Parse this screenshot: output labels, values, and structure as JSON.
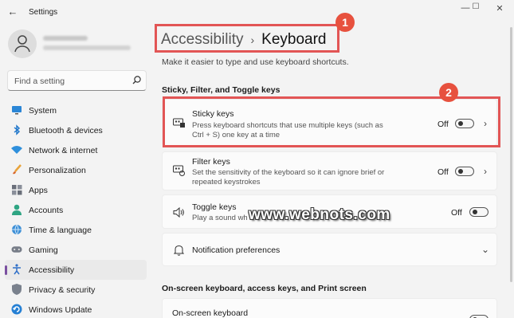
{
  "window": {
    "title": "Settings",
    "back_glyph": "←",
    "min_glyph": "—",
    "max_glyph": "☐",
    "close_glyph": "✕"
  },
  "sidebar": {
    "search_placeholder": "Find a setting",
    "items": [
      {
        "label": "System",
        "icon": "system-icon",
        "active": false
      },
      {
        "label": "Bluetooth & devices",
        "icon": "bluetooth-icon",
        "active": false
      },
      {
        "label": "Network & internet",
        "icon": "network-icon",
        "active": false
      },
      {
        "label": "Personalization",
        "icon": "brush-icon",
        "active": false
      },
      {
        "label": "Apps",
        "icon": "apps-icon",
        "active": false
      },
      {
        "label": "Accounts",
        "icon": "accounts-icon",
        "active": false
      },
      {
        "label": "Time & language",
        "icon": "globe-icon",
        "active": false
      },
      {
        "label": "Gaming",
        "icon": "gamepad-icon",
        "active": false
      },
      {
        "label": "Accessibility",
        "icon": "accessibility-icon",
        "active": true
      },
      {
        "label": "Privacy & security",
        "icon": "shield-icon",
        "active": false
      },
      {
        "label": "Windows Update",
        "icon": "update-icon",
        "active": false
      }
    ]
  },
  "main": {
    "breadcrumb": {
      "parent": "Accessibility",
      "separator": "›",
      "current": "Keyboard"
    },
    "description": "Make it easier to type and use keyboard shortcuts.",
    "section1": "Sticky, Filter, and Toggle keys",
    "sticky": {
      "title": "Sticky keys",
      "subtitle_1": "Press keyboard shortcuts that use multiple keys (such as",
      "subtitle_2": "Ctrl + S) one key at a time",
      "state": "Off"
    },
    "filter": {
      "title": "Filter keys",
      "subtitle_1": "Set the sensitivity of the keyboard so it can ignore brief or",
      "subtitle_2": "repeated keystrokes",
      "state": "Off"
    },
    "toggle_keys": {
      "title": "Toggle keys",
      "subtitle_1": "Play a sound wh",
      "state": "Off"
    },
    "notification": {
      "title": "Notification preferences"
    },
    "section2": "On-screen keyboard, access keys, and Print screen",
    "onscreen": {
      "title": "On-screen keyboard"
    }
  },
  "annotations": {
    "badge1": "1",
    "badge2": "2",
    "watermark": "www.webnots.com",
    "accent": "#e25555"
  }
}
